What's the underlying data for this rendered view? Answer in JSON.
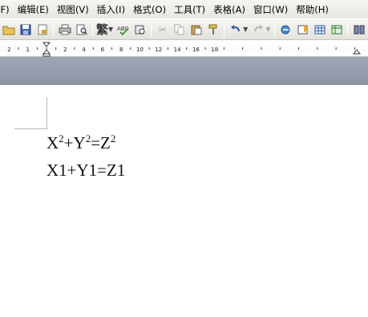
{
  "menubar": {
    "items": [
      {
        "id": "file",
        "label": "(F)",
        "cut": true
      },
      {
        "id": "edit",
        "label": "编辑(E)"
      },
      {
        "id": "view",
        "label": "视图(V)"
      },
      {
        "id": "insert",
        "label": "插入(I)"
      },
      {
        "id": "format",
        "label": "格式(O)"
      },
      {
        "id": "tools",
        "label": "工具(T)"
      },
      {
        "id": "table",
        "label": "表格(A)"
      },
      {
        "id": "window",
        "label": "窗口(W)"
      },
      {
        "id": "help",
        "label": "帮助(H)"
      }
    ]
  },
  "toolbar": {
    "chinese_convert_label": "繁",
    "buttons": [
      {
        "name": "open-icon",
        "glyph": "📂"
      },
      {
        "name": "save-icon",
        "glyph": "💾"
      },
      {
        "name": "permission-icon",
        "glyph": "🔒"
      },
      {
        "name": "print-icon",
        "glyph": "🖶"
      },
      {
        "name": "print-preview-icon",
        "glyph": "🔍"
      },
      {
        "name": "spelling-icon",
        "glyph": "✓"
      },
      {
        "name": "research-icon",
        "glyph": "📖"
      },
      {
        "name": "cut-icon",
        "glyph": "✂"
      },
      {
        "name": "copy-icon",
        "glyph": "⎘"
      },
      {
        "name": "paste-icon",
        "glyph": "📋"
      },
      {
        "name": "format-painter-icon",
        "glyph": "🖌"
      },
      {
        "name": "undo-icon",
        "glyph": "↶"
      },
      {
        "name": "redo-icon",
        "glyph": "↷"
      },
      {
        "name": "hyperlink-icon",
        "glyph": "🔗"
      },
      {
        "name": "tables-borders-icon",
        "glyph": "▦"
      },
      {
        "name": "insert-table-icon",
        "glyph": "⊞"
      },
      {
        "name": "insert-excel-icon",
        "glyph": "▣"
      },
      {
        "name": "columns-icon",
        "glyph": "▥"
      }
    ]
  },
  "ruler": {
    "left_numbers": [
      "2",
      "1"
    ],
    "right_numbers": [
      "2",
      "4",
      "6",
      "8",
      "10",
      "12",
      "14",
      "16",
      "18"
    ]
  },
  "document": {
    "line1": {
      "x": "X",
      "x_exp": "2",
      "plus": "+Y",
      "y_exp": "2",
      "eq": "=Z",
      "z_exp": "2"
    },
    "line2": "X1+Y1=Z1"
  },
  "colors": {
    "menubar_bg": "#ecebe6",
    "doc_background": "#979dad",
    "page": "#ffffff"
  }
}
